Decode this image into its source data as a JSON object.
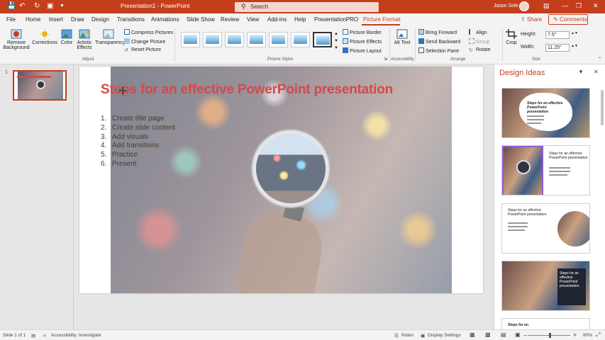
{
  "titlebar": {
    "doc_title": "Presentation1 - PowerPoint",
    "search_placeholder": "Search",
    "user_name": "Jason Sole",
    "accent": "#c43e1c"
  },
  "tabs": [
    "File",
    "Home",
    "Insert",
    "Draw",
    "Design",
    "Transitions",
    "Animations",
    "Slide Show",
    "Review",
    "View",
    "Add-ins",
    "Help",
    "PresentationPRO",
    "Picture Format"
  ],
  "active_tab": "Picture Format",
  "share_label": "Share",
  "comments_label": "Comments",
  "ribbon": {
    "remove_background": "Remove Background",
    "corrections": "Corrections",
    "color": "Color",
    "artistic_effects": "Artistic Effects",
    "transparency": "Transparency",
    "compress_pictures": "Compress Pictures",
    "change_picture": "Change Picture",
    "reset_picture": "Reset Picture",
    "group_adjust": "Adjust",
    "group_picture_styles": "Picture Styles",
    "picture_border": "Picture Border",
    "picture_effects": "Picture Effects",
    "picture_layout": "Picture Layout",
    "alt_text": "Alt Text",
    "group_accessibility": "Accessibility",
    "bring_forward": "Bring Forward",
    "send_backward": "Send Backward",
    "selection_pane": "Selection Pane",
    "align": "Align",
    "group_label": "Group",
    "rotate": "Rotate",
    "group_arrange": "Arrange",
    "crop": "Crop",
    "height_label": "Height:",
    "height_value": "7.5\"",
    "width_label": "Width:",
    "width_value": "11.25\"",
    "group_size": "Size"
  },
  "thumbnail_number": "1",
  "slide": {
    "title": "Steps for an effective PowerPoint presentation",
    "bullets": [
      {
        "num": "1.",
        "text": "Create title page"
      },
      {
        "num": "2.",
        "text": "Create slide content"
      },
      {
        "num": "3.",
        "text": "Add visuals"
      },
      {
        "num": "4.",
        "text": "Add transitions"
      },
      {
        "num": "5.",
        "text": "Practice"
      },
      {
        "num": "6.",
        "text": "Present"
      }
    ]
  },
  "design_ideas": {
    "title": "Design Ideas",
    "idea1_title": "Steps for an effective PowerPoint presentation",
    "idea2_title": "Steps for an effective PowerPoint presentation",
    "idea3_title": "Steps for an effective PowerPoint presentation",
    "idea4_title": "Steps for an effective PowerPoint presentation",
    "idea5_title": "Steps for an"
  },
  "status": {
    "slide_count": "Slide 1 of 1",
    "accessibility": "Accessibility: Investigate",
    "notes": "Notes",
    "display_settings": "Display Settings",
    "zoom": "80%"
  }
}
